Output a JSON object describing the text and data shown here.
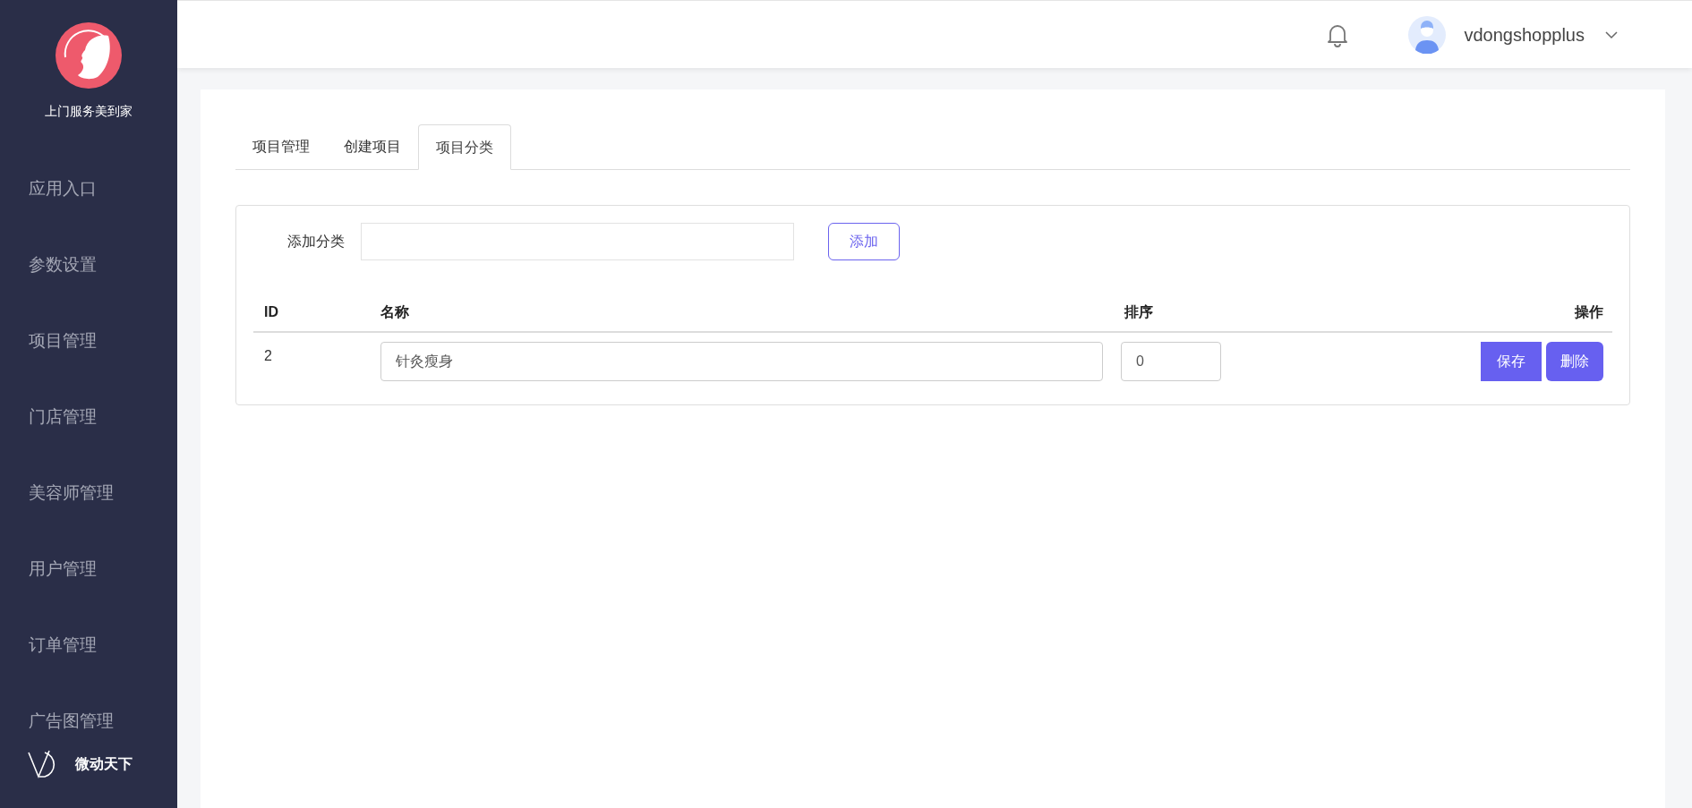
{
  "sidebar": {
    "brand": "上门服务美到家",
    "items": [
      {
        "label": "应用入口",
        "selected": false
      },
      {
        "label": "参数设置",
        "selected": false
      },
      {
        "label": "项目管理",
        "selected": false
      },
      {
        "label": "门店管理",
        "selected": false
      },
      {
        "label": "美容师管理",
        "selected": false
      },
      {
        "label": "用户管理",
        "selected": false
      },
      {
        "label": "订单管理",
        "selected": false
      },
      {
        "label": "广告图管理",
        "selected": false
      }
    ],
    "footer_brand": "微动天下"
  },
  "header": {
    "username": "vdongshopplus"
  },
  "tabs": [
    {
      "label": "项目管理",
      "selected": false
    },
    {
      "label": "创建项目",
      "selected": false
    },
    {
      "label": "项目分类",
      "selected": true
    }
  ],
  "add_form": {
    "label": "添加分类",
    "button": "添加"
  },
  "table": {
    "columns": [
      "ID",
      "名称",
      "排序",
      "操作"
    ],
    "rows": [
      {
        "id": "2",
        "name": "针灸瘦身",
        "sort": "0",
        "actions": [
          "保存",
          "删除"
        ]
      }
    ]
  }
}
